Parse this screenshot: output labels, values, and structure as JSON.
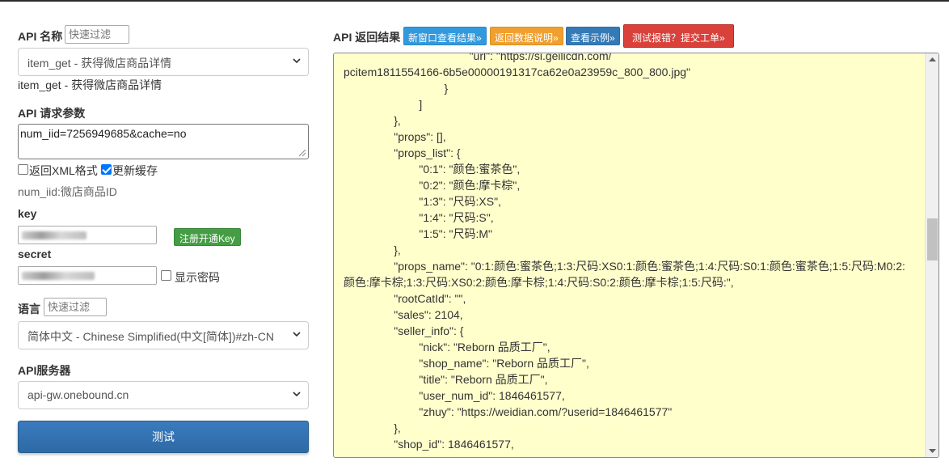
{
  "left": {
    "api_name_label": "API 名称",
    "filter_placeholder": "快速过滤",
    "api_select_value": "item_get - 获得微店商品详情",
    "api_description": "item_get - 获得微店商品详情",
    "params_label": "API 请求参数",
    "params_value": "num_iid=7256949685&cache=no",
    "xml_checkbox_label": "返回XML格式",
    "xml_checked": false,
    "cache_checkbox_label": "更新缓存",
    "cache_checked": true,
    "param_hint": "num_iid:微店商品ID",
    "key_label": "key",
    "register_key_button": "注册开通Key",
    "secret_label": "secret",
    "show_password_label": "显示密码",
    "show_password_checked": false,
    "language_label": "语言",
    "language_select_value": "简体中文 - Chinese Simplified(中文[简体])#zh-CN",
    "server_label": "API服务器",
    "server_select_value": "api-gw.onebound.cn",
    "test_button": "测试"
  },
  "right": {
    "title": "API 返回结果",
    "buttons": {
      "new_window": "新窗口查看结果»",
      "data_desc": "返回数据说明»",
      "examples": "查看示例»",
      "report_error": "测试报错？提交工单»"
    },
    "result_lines": [
      "                                        \"url\": \"https://si.geilicdn.com/",
      "pcitem1811554166-6b5e00000191317ca62e0a23959c_800_800.jpg\"",
      "                                }",
      "                        ]",
      "                },",
      "                \"props\": [],",
      "                \"props_list\": {",
      "                        \"0:1\": \"颜色:蜜茶色\",",
      "                        \"0:2\": \"颜色:摩卡棕\",",
      "                        \"1:3\": \"尺码:XS\",",
      "                        \"1:4\": \"尺码:S\",",
      "                        \"1:5\": \"尺码:M\"",
      "                },",
      "                \"props_name\": \"0:1:颜色:蜜茶色;1:3:尺码:XS0:1:颜色:蜜茶色;1:4:尺码:S0:1:颜色:蜜茶色;1:5:尺码:M0:2:",
      "颜色:摩卡棕;1:3:尺码:XS0:2:颜色:摩卡棕;1:4:尺码:S0:2:颜色:摩卡棕;1:5:尺码:\",",
      "                \"rootCatId\": \"\",",
      "                \"sales\": 2104,",
      "                \"seller_info\": {",
      "                        \"nick\": \"Reborn 品质工厂\",",
      "                        \"shop_name\": \"Reborn 品质工厂\",",
      "                        \"title\": \"Reborn 品质工厂\",",
      "                        \"user_num_id\": 1846461577,",
      "                        \"zhuy\": \"https://weidian.com/?userid=1846461577\"",
      "                },",
      "                \"shop_id\": 1846461577,"
    ]
  }
}
